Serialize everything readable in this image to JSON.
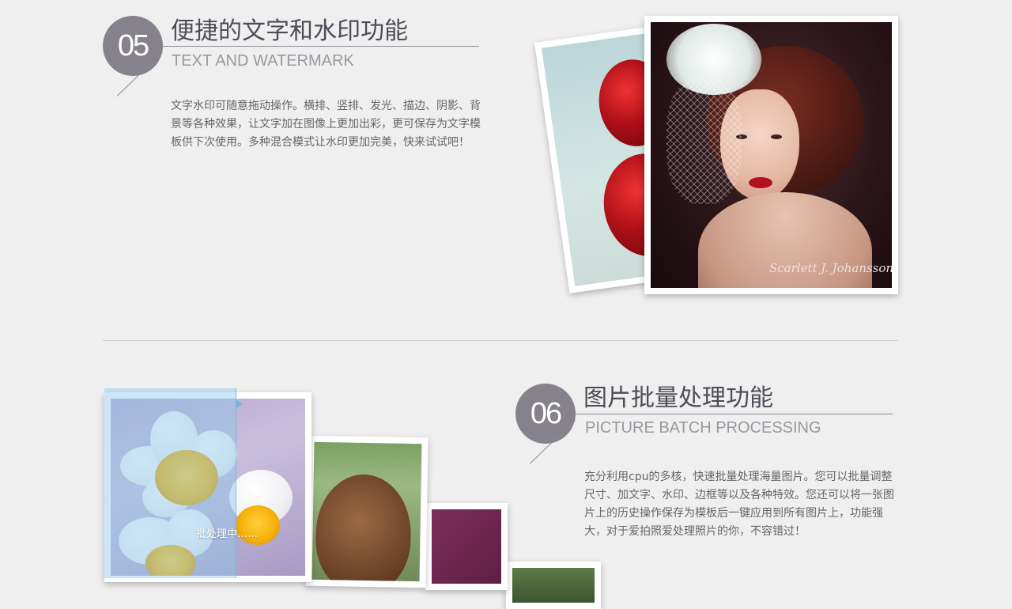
{
  "section05": {
    "number": "05",
    "title_cn": "便捷的文字和水印功能",
    "title_en": "TEXT AND WATERMARK",
    "description": "文字水印可随意拖动操作。横排、竖排、发光、描边、阴影、背景等各种效果，让文字加在图像上更加出彩，更可保存为文字模板供下次使用。多种混合模式让水印更加完美，快来试试吧！",
    "photo_watermark": "Scarlett J. Johansson"
  },
  "section06": {
    "number": "06",
    "title_cn": "图片批量处理功能",
    "title_en": "PICTURE BATCH PROCESSING",
    "description": "充分利用cpu的多核，快速批量处理海量图片。您可以批量调整尺寸、加文字、水印、边框等以及各种特效。您还可以将一张图片上的历史操作保存为模板后一键应用到所有图片上，功能强大，对于爱拍照爱处理照片的你，不容错过！",
    "processing_label": "批处理中……"
  },
  "colors": {
    "badge": "#86828b",
    "title": "#4f4b57",
    "subtitle": "#9a97a0",
    "body_text": "#666666",
    "background": "#efefef",
    "overlay": "#8cc8eb"
  }
}
